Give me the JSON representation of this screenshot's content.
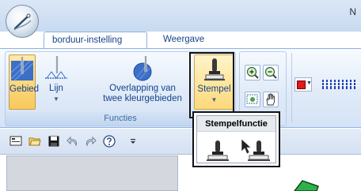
{
  "window": {
    "title_fragment": "N"
  },
  "tabs": [
    {
      "label": "borduur-instelling",
      "active": true
    },
    {
      "label": "Weergave",
      "active": false
    }
  ],
  "ribbon": {
    "group_label": "Functies",
    "buttons": [
      {
        "label": "Gebied",
        "icon": "area-needle-icon",
        "state": "selected"
      },
      {
        "label": "Lijn",
        "icon": "line-needle-icon",
        "state": "normal"
      },
      {
        "label_line1": "Overlapping van",
        "label_line2": "twee kleurgebieden",
        "icon": "overlap-needle-icon",
        "state": "normal"
      },
      {
        "label": "Stempel",
        "icon": "stamp-icon",
        "state": "hover"
      }
    ],
    "view_buttons": [
      "zoom-in-icon",
      "zoom-out-icon",
      "select-area-icon",
      "pan-hand-icon"
    ],
    "color_swatch": "#e0191b"
  },
  "popup": {
    "title": "Stempelfunctie",
    "items": [
      "stamp-icon",
      "stamp-select-icon"
    ]
  },
  "quick_access": [
    "screen-icon",
    "open-folder-icon",
    "save-icon",
    "undo-icon",
    "redo-icon",
    "help-icon",
    "customize-icon"
  ]
}
